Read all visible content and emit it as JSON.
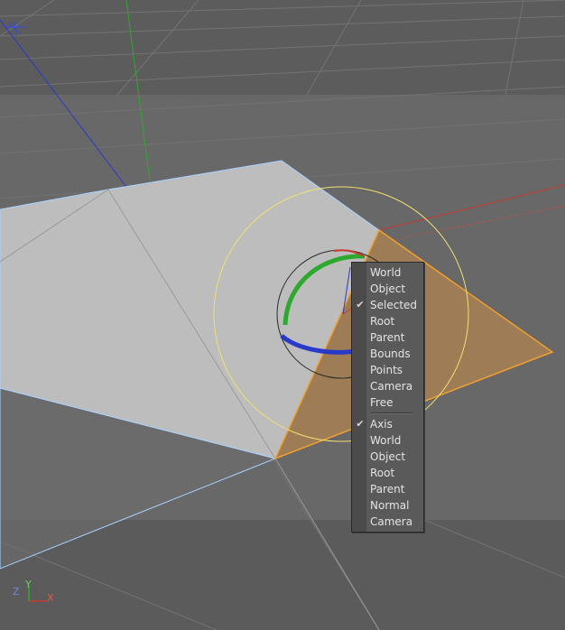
{
  "axis_gizmo": {
    "x": "X",
    "y": "Y",
    "z": "Z"
  },
  "menu": {
    "section1": [
      {
        "label": "World",
        "checked": false
      },
      {
        "label": "Object",
        "checked": false
      },
      {
        "label": "Selected",
        "checked": true
      },
      {
        "label": "Root",
        "checked": false
      },
      {
        "label": "Parent",
        "checked": false
      },
      {
        "label": "Bounds",
        "checked": false
      },
      {
        "label": "Points",
        "checked": false
      },
      {
        "label": "Camera",
        "checked": false
      },
      {
        "label": "Free",
        "checked": false
      }
    ],
    "section2": [
      {
        "label": "Axis",
        "checked": true
      },
      {
        "label": "World",
        "checked": false
      },
      {
        "label": "Object",
        "checked": false
      },
      {
        "label": "Root",
        "checked": false
      },
      {
        "label": "Parent",
        "checked": false
      },
      {
        "label": "Normal",
        "checked": false
      },
      {
        "label": "Camera",
        "checked": false
      }
    ],
    "check_glyph": "✔"
  },
  "colors": {
    "x_axis": "#c83a2e",
    "y_axis": "#2fa82f",
    "z_axis": "#2a3ac8",
    "selection": "#f0a030",
    "gizmo_ring": "#f0e070"
  }
}
